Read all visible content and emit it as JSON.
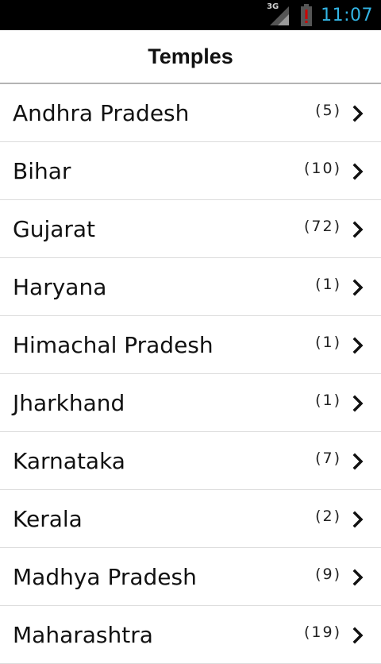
{
  "status_bar": {
    "network": "3G",
    "time": "11:07",
    "icons": [
      "signal-icon",
      "battery-alert-icon"
    ]
  },
  "header": {
    "title": "Temples"
  },
  "list": {
    "items": [
      {
        "label": "Andhra Pradesh",
        "count": "(5)"
      },
      {
        "label": "Bihar",
        "count": "(10)"
      },
      {
        "label": "Gujarat",
        "count": "(72)"
      },
      {
        "label": "Haryana",
        "count": "(1)"
      },
      {
        "label": "Himachal Pradesh",
        "count": "(1)"
      },
      {
        "label": "Jharkhand",
        "count": "(1)"
      },
      {
        "label": "Karnataka",
        "count": "(7)"
      },
      {
        "label": "Kerala",
        "count": "(2)"
      },
      {
        "label": "Madhya Pradesh",
        "count": "(9)"
      },
      {
        "label": "Maharashtra",
        "count": "(19)"
      }
    ],
    "chevron_icon": "chevron-right-icon"
  },
  "colors": {
    "status_bar_bg": "#000000",
    "clock": "#33b5e5",
    "battery_alert": "#cc0000",
    "header_divider": "#b4b4b4",
    "row_divider": "#dcdcdc"
  }
}
